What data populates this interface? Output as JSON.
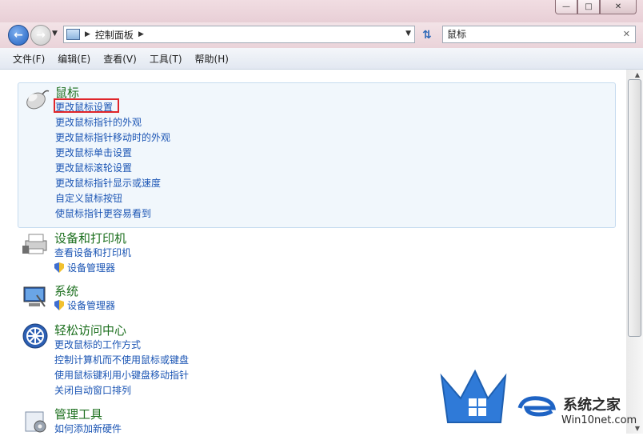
{
  "window": {
    "controls": {
      "minimize": "—",
      "maximize": "□",
      "close": "✕"
    }
  },
  "address": {
    "crumb": "控制面板",
    "search_value": "鼠标"
  },
  "menu": {
    "items": [
      "文件(F)",
      "编辑(E)",
      "查看(V)",
      "工具(T)",
      "帮助(H)"
    ]
  },
  "groups": {
    "mouse": {
      "title": "鼠标",
      "links": [
        "更改鼠标设置",
        "更改鼠标指针的外观",
        "更改鼠标指针移动时的外观",
        "更改鼠标单击设置",
        "更改鼠标滚轮设置",
        "更改鼠标指针显示或速度",
        "自定义鼠标按钮",
        "使鼠标指针更容易看到"
      ]
    },
    "devices": {
      "title": "设备和打印机",
      "link": "查看设备和打印机",
      "shield_link": "设备管理器"
    },
    "system": {
      "title": "系统",
      "shield_link": "设备管理器"
    },
    "ease": {
      "title": "轻松访问中心",
      "links": [
        "更改鼠标的工作方式",
        "控制计算机而不使用鼠标或键盘",
        "使用鼠标键利用小键盘移动指针",
        "关闭自动窗口排列"
      ]
    },
    "admin": {
      "title": "管理工具",
      "link": "如何添加新硬件"
    }
  },
  "watermark": {
    "line1": "系统之家",
    "line2": "Win10net.com"
  },
  "colors": {
    "link": "#1b55b4",
    "group_title": "#1c6f1e",
    "highlight_border": "#e0262b"
  }
}
